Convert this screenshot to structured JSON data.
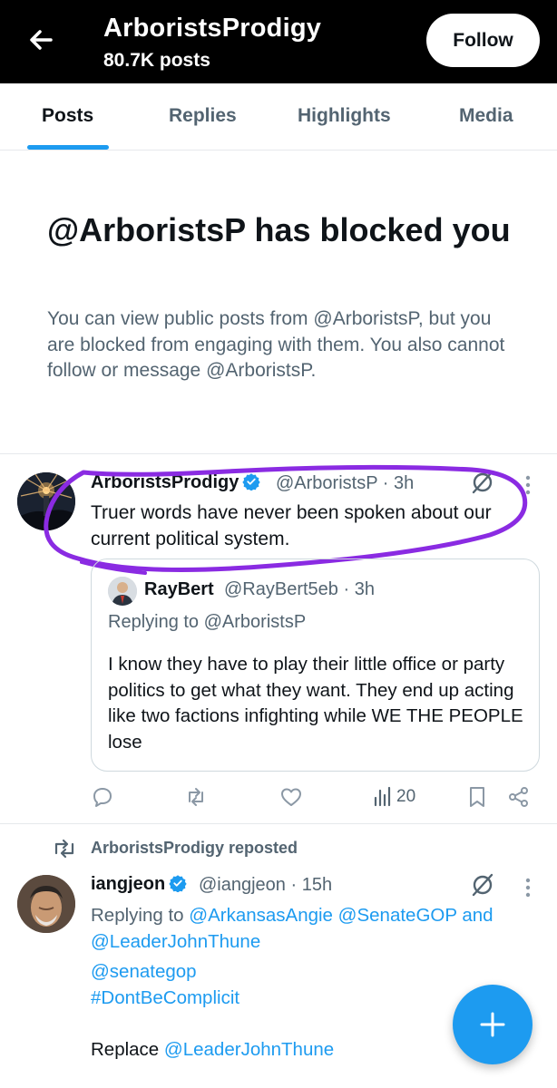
{
  "header": {
    "title": "ArboristsProdigy",
    "post_count": "80.7K posts",
    "follow_label": "Follow",
    "back_icon": "arrow-left-icon"
  },
  "tabs": [
    {
      "label": "Posts",
      "active": true
    },
    {
      "label": "Replies",
      "active": false
    },
    {
      "label": "Highlights",
      "active": false
    },
    {
      "label": "Media",
      "active": false
    }
  ],
  "blocked_notice": {
    "title": "@ArboristsP has blocked you",
    "description": "You can view public posts from @ArboristsP, but you are blocked from engaging with them. You also cannot follow or message @ArboristsP."
  },
  "tweet1": {
    "author_name": "ArboristsProdigy",
    "handle_time": "@ArboristsP · 3h",
    "text": "Truer words have never been spoken about our current political system.",
    "annotation_color": "#8a2be2",
    "quote": {
      "author_name": "RayBert",
      "handle_time": "@RayBert5eb · 3h",
      "replying_to": "Replying to @ArboristsP",
      "text": "I know they have to play their little office or party politics to get what they want. They end up acting like two factions infighting while WE THE PEOPLE lose"
    },
    "actions": {
      "reply_icon": "reply-icon",
      "repost_icon": "repost-icon",
      "like_icon": "like-icon",
      "views_icon": "views-icon",
      "views_count": "20",
      "bookmark_icon": "bookmark-icon",
      "share_icon": "share-icon"
    }
  },
  "repost_header": "ArboristsProdigy reposted",
  "tweet2": {
    "author_name": "iangjeon",
    "handle_time": "@iangjeon · 15h",
    "replying_prefix": "Replying to ",
    "mention1": "@ArkansasAngie",
    "mention2": "@SenateGOP",
    "and_word": " and",
    "mention3": "@LeaderJohnThune",
    "tag1": "@senategop",
    "tag2": "#DontBeComplicit",
    "last_prefix": "Replace ",
    "last_mention": "@LeaderJohnThune"
  },
  "colors": {
    "accent": "#1d9bf0",
    "header_bg": "#000000",
    "muted_text": "#536471"
  }
}
